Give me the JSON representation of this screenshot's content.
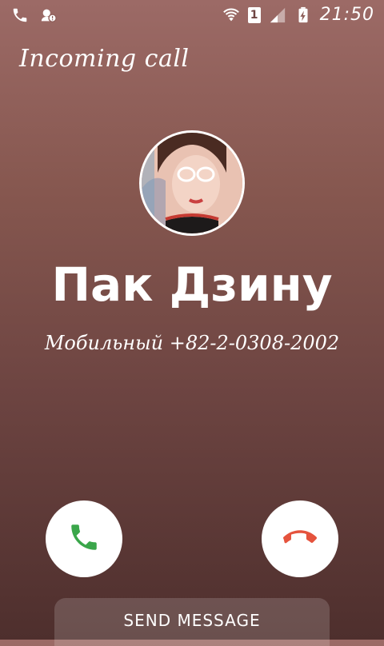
{
  "status_bar": {
    "sim_slot": "1",
    "time": "21:50",
    "icons": [
      "phone-icon",
      "contact-alert-icon",
      "wifi-icon",
      "signal-icon",
      "battery-charging-icon"
    ]
  },
  "call": {
    "heading": "Incoming call",
    "caller_name": "Пак Дзину",
    "caller_line": "Мобильный +82-2-0308-2002"
  },
  "actions": {
    "send_message_label": "SEND MESSAGE",
    "answer_color": "#3aa64a",
    "decline_color": "#e5533d"
  }
}
